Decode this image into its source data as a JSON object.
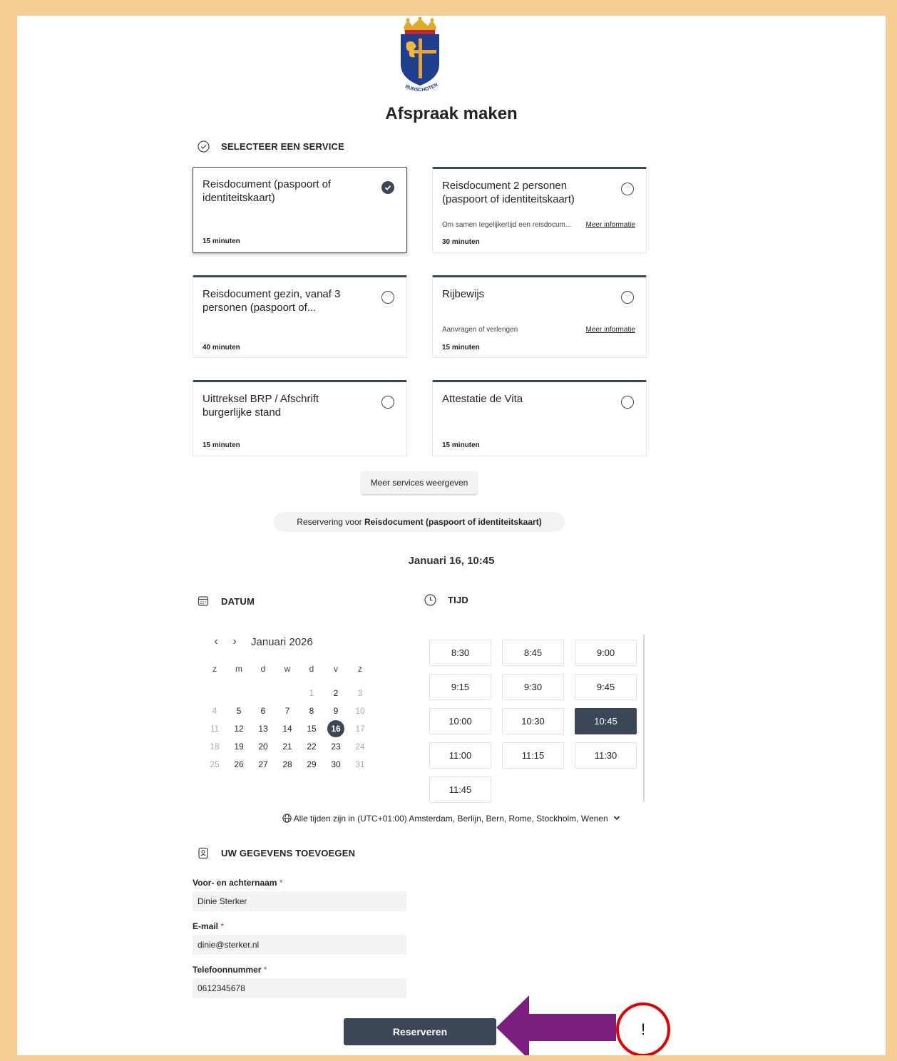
{
  "page": {
    "title": "Afspraak maken",
    "logo_text": "BUNSCHOTEN"
  },
  "services_section": {
    "heading": "SELECTEER EEN SERVICE",
    "cards": [
      {
        "name": "Reisdocument (paspoort of identiteitskaart)",
        "description": "",
        "more": "",
        "duration": "15 minuten",
        "selected": true
      },
      {
        "name": "Reisdocument 2 personen (paspoort of identiteitskaart)",
        "description": "Om samen tegelijkertijd een reisdocum...",
        "more": "Meer informatie",
        "duration": "30 minuten",
        "selected": false
      },
      {
        "name": "Reisdocument gezin, vanaf 3 personen (paspoort of...",
        "description": "",
        "more": "",
        "duration": "40 minuten",
        "selected": false
      },
      {
        "name": "Rijbewijs",
        "description": "Aanvragen of verlengen",
        "more": "Meer informatie",
        "duration": "15 minuten",
        "selected": false
      },
      {
        "name": "Uittreksel BRP / Afschrift burgerlijke stand",
        "description": "",
        "more": "",
        "duration": "15 minuten",
        "selected": false
      },
      {
        "name": "Attestatie de Vita",
        "description": "",
        "more": "",
        "duration": "15 minuten",
        "selected": false
      }
    ],
    "more_button": "Meer services weergeven"
  },
  "reservation": {
    "prefix": "Reservering voor ",
    "service": "Reisdocument (paspoort of identiteitskaart)",
    "chosen_datetime": "Januari 16, 10:45"
  },
  "date_section": {
    "heading": "DATUM",
    "month_label": "Januari 2026",
    "weekdays": [
      "z",
      "m",
      "d",
      "w",
      "d",
      "v",
      "z"
    ],
    "weeks": [
      [
        "",
        "",
        "",
        "",
        "1",
        "2",
        "3"
      ],
      [
        "4",
        "5",
        "6",
        "7",
        "8",
        "9",
        "10"
      ],
      [
        "11",
        "12",
        "13",
        "14",
        "15",
        "16",
        "17"
      ],
      [
        "18",
        "19",
        "20",
        "21",
        "22",
        "23",
        "24"
      ],
      [
        "25",
        "26",
        "27",
        "28",
        "29",
        "30",
        "31"
      ]
    ],
    "selected_day": "16"
  },
  "time_section": {
    "heading": "TIJD",
    "slots": [
      "8:30",
      "8:45",
      "9:00",
      "9:15",
      "9:30",
      "9:45",
      "10:00",
      "10:30",
      "10:45",
      "11:00",
      "11:15",
      "11:30",
      "11:45"
    ],
    "selected_slot": "10:45"
  },
  "timezone": {
    "prefix": "Alle tijden zijn in ",
    "value": "(UTC+01:00) Amsterdam, Berlijn, Bern, Rome, Stockholm, Wenen"
  },
  "details_section": {
    "heading": "UW GEGEVENS TOEVOEGEN",
    "name_label": "Voor- en achternaam",
    "name_value": "Dinie Sterker",
    "email_label": "E-mail",
    "email_value": "dinie@sterker.nl",
    "phone_label": "Telefoonnummer",
    "phone_value": "0612345678",
    "required_mark": "*"
  },
  "submit_label": "Reserveren",
  "annotation": {
    "mark": "!",
    "arrow_color": "#7a1f7d",
    "circle_color": "#e00000"
  },
  "colors": {
    "frame": "#f7cd96",
    "accent": "#3b4656"
  }
}
